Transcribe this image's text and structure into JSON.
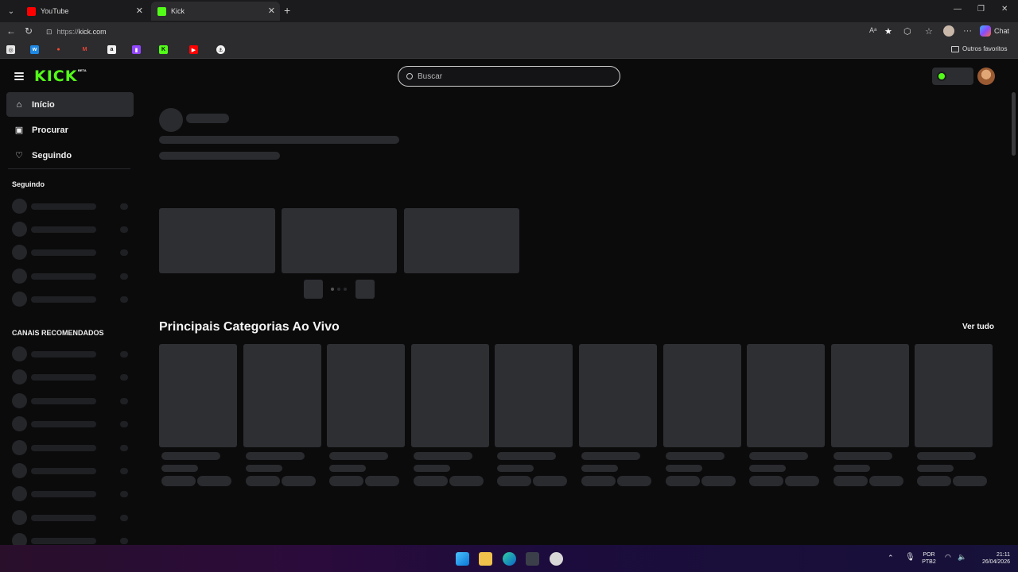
{
  "browser": {
    "tabs": [
      {
        "title": "YouTube",
        "favicon_color": "#ff0000",
        "active": false
      },
      {
        "title": "Kick",
        "favicon_color": "#53fc18",
        "active": true
      }
    ],
    "url_scheme": "https://",
    "url_host": "kick.com",
    "chat_label": "Chat",
    "other_favorites_label": "Outros favoritos"
  },
  "site": {
    "logo_text": "KICK",
    "beta_label": "BETA",
    "search_placeholder": "Buscar",
    "accent_color": "#53fc18"
  },
  "sidebar": {
    "items": [
      {
        "label": "Início",
        "icon": "home-icon",
        "active": true
      },
      {
        "label": "Procurar",
        "icon": "browse-icon",
        "active": false
      },
      {
        "label": "Seguindo",
        "icon": "heart-icon",
        "active": false
      }
    ],
    "following_heading": "Seguindo",
    "recommended_heading": "CANAIS RECOMENDADOS"
  },
  "main": {
    "categories_title": "Principais Categorias Ao Vivo",
    "see_all_label": "Ver tudo"
  },
  "taskbar": {
    "lang_top": "POR",
    "lang_bottom": "PTB2",
    "time": "21:11",
    "date": "26/04/2026"
  }
}
